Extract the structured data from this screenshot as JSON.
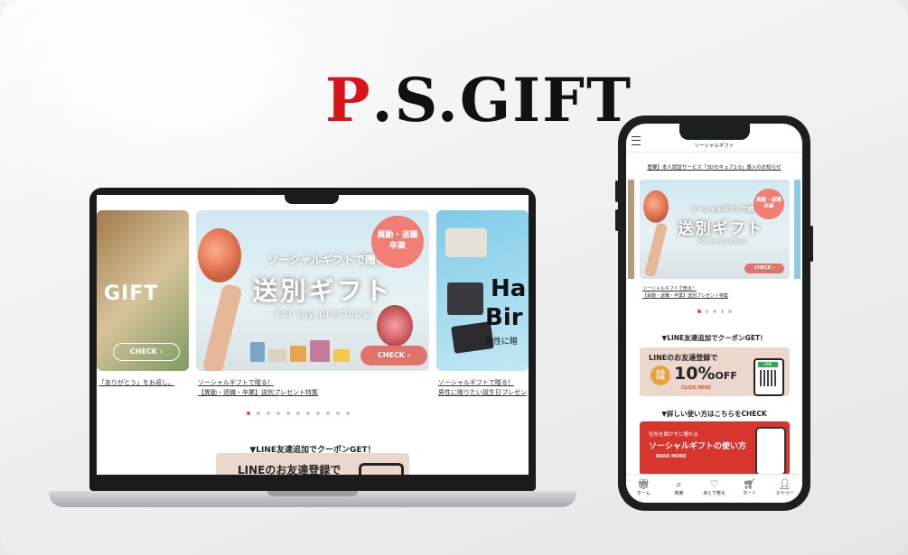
{
  "brand": {
    "logo_first": "P",
    "logo_rest": ".S.GIFT"
  },
  "laptop": {
    "slide1": {
      "title": "GIFT",
      "check": "CHECK ›",
      "caption": "「ありがとう」をお返し。"
    },
    "slide2": {
      "subtitle": "ソーシャルギフトで贈る",
      "title": "送別ギフト",
      "english": "For my precious!",
      "badge": "異動・退職\n卒業",
      "check": "CHECK ›",
      "caption_line1": "ソーシャルギフトで贈る！",
      "caption_line2": "【異動・退職・卒業】送別プレゼント特集"
    },
    "slide3": {
      "title_line1": "Ha",
      "title_line2": "Bir",
      "subtitle": "男性に贈",
      "caption_line1": "ソーシャルギフトで贈る！",
      "caption_line2": "男性に贈りたい誕生日プレゼン"
    },
    "dots_total": 11,
    "dots_active": 0,
    "line_heading": "▼LINE友達追加でクーポンGET！",
    "line_banner": "LINEのお友達登録で"
  },
  "phone": {
    "page_title": "ソーシャルギフト",
    "notice": "重要】本人認証サービス「3Dセキュア2.0」導入のお知らせ",
    "slide": {
      "subtitle": "ソーシャルギフトで贈る",
      "title": "送別ギフト",
      "english": "For my precious!",
      "badge": "異動・退職\n卒業",
      "check": "CHECK ›"
    },
    "caption_line1": "ソーシャルギフトで贈る！",
    "caption_line2": "【異動・退職・卒業】送別プレゼント特集",
    "dots_total": 5,
    "dots_active": 0,
    "line_heading": "▼LINE友達追加でクーポンGET！",
    "line_banner": {
      "title": "LINEのお友達登録で",
      "circle": "全品\n対象",
      "discount": "10%",
      "off": "OFF",
      "here": "CLICK HERE",
      "qr_label": "LINE"
    },
    "howto_heading": "▼詳しい使い方はこちらをCHECK",
    "howto_banner": {
      "subtitle": "住所を聞かずに贈れる",
      "title": "ソーシャルギフトの使い方",
      "more": "READ MORE"
    },
    "tabs": [
      {
        "icon": "gift-icon",
        "label": "ホーム"
      },
      {
        "icon": "search-icon",
        "label": "検索"
      },
      {
        "icon": "heart-icon",
        "label": "あとで贈る"
      },
      {
        "icon": "cart-icon",
        "label": "カート"
      },
      {
        "icon": "user-icon",
        "label": "マイペー"
      }
    ]
  },
  "colors": {
    "brand_red": "#d7141c",
    "accent_coral": "#e0736b",
    "dot_active": "#e64a3d",
    "howto_red": "#d9352f"
  }
}
